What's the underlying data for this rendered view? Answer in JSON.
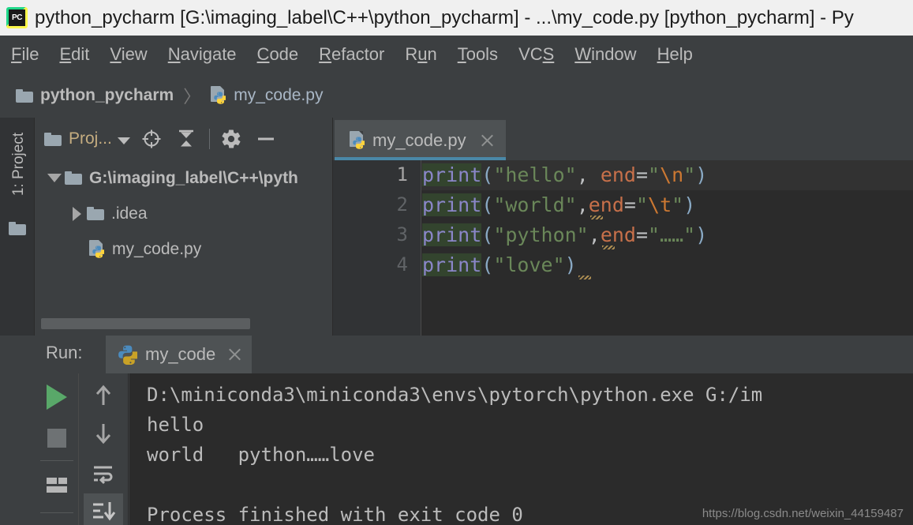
{
  "window": {
    "logo_icon": "pycharm-logo-icon",
    "title": "python_pycharm [G:\\imaging_label\\C++\\python_pycharm] - ...\\my_code.py [python_pycharm] - Py"
  },
  "menubar": {
    "items": [
      {
        "label": "File",
        "mnemonic": "F"
      },
      {
        "label": "Edit",
        "mnemonic": "E"
      },
      {
        "label": "View",
        "mnemonic": "V"
      },
      {
        "label": "Navigate",
        "mnemonic": "N"
      },
      {
        "label": "Code",
        "mnemonic": "C"
      },
      {
        "label": "Refactor",
        "mnemonic": "R"
      },
      {
        "label": "Run",
        "mnemonic": "u"
      },
      {
        "label": "Tools",
        "mnemonic": "T"
      },
      {
        "label": "VCS",
        "mnemonic": "S"
      },
      {
        "label": "Window",
        "mnemonic": "W"
      },
      {
        "label": "Help",
        "mnemonic": "H"
      }
    ]
  },
  "breadcrumb": {
    "project": "python_pycharm",
    "separator": "〉",
    "file": "my_code.py"
  },
  "left_strip": {
    "tool_window": "1: Project",
    "tool_window_number": "1",
    "tool_window_name": ": Project",
    "folder_icon": "folder-icon"
  },
  "project_panel": {
    "toolbar": {
      "title": "Proj...",
      "caret_icon": "chevron-down-icon",
      "locate_icon": "target-crosshair-icon",
      "collapse_icon": "collapse-all-icon",
      "settings_icon": "gear-icon",
      "hide_icon": "minimize-icon"
    },
    "tree": [
      {
        "label": "G:\\imaging_label\\C++\\pyth",
        "icon": "folder-icon",
        "twisty": "expanded",
        "indent": 0,
        "bold": true
      },
      {
        "label": ".idea",
        "icon": "folder-icon",
        "twisty": "collapsed",
        "indent": 1,
        "bold": false
      },
      {
        "label": "my_code.py",
        "icon": "python-file-icon",
        "twisty": "none",
        "indent": 2,
        "bold": false
      }
    ]
  },
  "editor": {
    "tab": {
      "label": "my_code.py",
      "icon": "python-file-icon",
      "close_icon": "close-icon",
      "active": true
    },
    "line_numbers": [
      "1",
      "2",
      "3",
      "4"
    ],
    "current_line": 1,
    "lines": [
      {
        "n": "1",
        "tokens": [
          {
            "t": "print",
            "c": "fn"
          },
          {
            "t": "(",
            "c": "paren"
          },
          {
            "t": "\"hello\"",
            "c": "str"
          },
          {
            "t": ",",
            "c": "punct"
          },
          {
            "t": " ",
            "c": "punct"
          },
          {
            "t": "end",
            "c": "kwarg"
          },
          {
            "t": "=",
            "c": "eq"
          },
          {
            "t": "\"",
            "c": "str"
          },
          {
            "t": "\\n",
            "c": "esc"
          },
          {
            "t": "\"",
            "c": "str"
          },
          {
            "t": ")",
            "c": "paren"
          }
        ]
      },
      {
        "n": "2",
        "tokens": [
          {
            "t": "print",
            "c": "fn"
          },
          {
            "t": "(",
            "c": "paren"
          },
          {
            "t": "\"world\"",
            "c": "str"
          },
          {
            "t": ",",
            "c": "punct"
          },
          {
            "t": "end",
            "c": "kwarg"
          },
          {
            "t": "=",
            "c": "eq"
          },
          {
            "t": "\"",
            "c": "str"
          },
          {
            "t": "\\t",
            "c": "esc"
          },
          {
            "t": "\"",
            "c": "str"
          },
          {
            "t": ")",
            "c": "paren"
          }
        ]
      },
      {
        "n": "3",
        "tokens": [
          {
            "t": "print",
            "c": "fn"
          },
          {
            "t": "(",
            "c": "paren"
          },
          {
            "t": "\"python\"",
            "c": "str"
          },
          {
            "t": ",",
            "c": "punct"
          },
          {
            "t": "end",
            "c": "kwarg"
          },
          {
            "t": "=",
            "c": "eq"
          },
          {
            "t": "\"……\"",
            "c": "str"
          },
          {
            "t": ")",
            "c": "paren"
          }
        ]
      },
      {
        "n": "4",
        "tokens": [
          {
            "t": "print",
            "c": "fn"
          },
          {
            "t": "(",
            "c": "paren"
          },
          {
            "t": "\"love\"",
            "c": "str"
          },
          {
            "t": ")",
            "c": "paren"
          }
        ]
      }
    ]
  },
  "run_panel": {
    "label": "Run:",
    "tab": {
      "label": "my_code",
      "icon": "python-icon",
      "close_icon": "close-icon"
    },
    "toolbar_left": [
      {
        "name": "rerun-button",
        "icon": "play-icon"
      },
      {
        "name": "stop-button",
        "icon": "stop-icon"
      },
      {
        "name": "layout-button",
        "icon": "layout-icon"
      }
    ],
    "toolbar_right": [
      {
        "name": "prev-occurrence-button",
        "icon": "arrow-up-icon"
      },
      {
        "name": "next-occurrence-button",
        "icon": "arrow-down-icon"
      },
      {
        "name": "soft-wrap-button",
        "icon": "soft-wrap-icon"
      },
      {
        "name": "scroll-to-end-button",
        "icon": "scroll-to-end-icon"
      }
    ],
    "console_lines": [
      "D:\\miniconda3\\miniconda3\\envs\\pytorch\\python.exe G:/im",
      "hello",
      "world   python……love",
      "",
      "Process finished with exit code 0"
    ]
  },
  "watermark": "https://blog.csdn.net/weixin_44159487",
  "colors": {
    "titlebar_bg": "#F0F0F0",
    "chrome_bg": "#3C3F41",
    "editor_bg": "#2B2B2B",
    "panel_bg": "#313335",
    "tab_active_underline": "#4A88A8",
    "text": "#BBBBBB",
    "string": "#6A8759",
    "function": "#8A86C8",
    "kwarg": "#C7704A",
    "escape": "#CC7832",
    "run_green": "#59A869",
    "proj_label": "#C5AD80"
  }
}
